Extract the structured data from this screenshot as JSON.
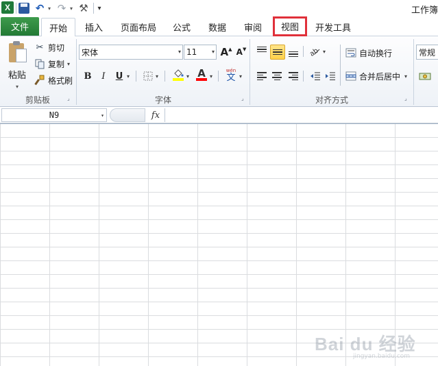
{
  "window": {
    "title": "工作簿"
  },
  "quick_access": {
    "logo_letter": "X",
    "undo_glyph": "↶",
    "redo_glyph": "↷",
    "tools_glyph": "⚒",
    "customize_glyph": "▾"
  },
  "tabs": [
    {
      "label": "文件",
      "state": "file"
    },
    {
      "label": "开始",
      "state": "active"
    },
    {
      "label": "插入"
    },
    {
      "label": "页面布局"
    },
    {
      "label": "公式"
    },
    {
      "label": "数据"
    },
    {
      "label": "审阅"
    },
    {
      "label": "视图",
      "state": "highlighted"
    },
    {
      "label": "开发工具"
    }
  ],
  "ribbon": {
    "clipboard": {
      "label": "剪贴板",
      "paste": "粘贴",
      "cut": "剪切",
      "copy": "复制",
      "format_painter": "格式刷"
    },
    "font": {
      "label": "字体",
      "font_name": "宋体",
      "font_size": "11",
      "grow_glyph": "A",
      "shrink_glyph": "A",
      "bold": "B",
      "italic": "I",
      "underline": "U",
      "font_color_glyph": "A",
      "phonetic_top": "wén",
      "phonetic_bottom": "文",
      "fill_color": "#ffff00",
      "text_color": "#ff0000"
    },
    "alignment": {
      "label": "对齐方式",
      "wrap_text": "自动换行",
      "merge_center": "合并后居中"
    },
    "number": {
      "format": "常规"
    }
  },
  "formula_bar": {
    "name_box": "N9",
    "fx": "fx",
    "value": ""
  },
  "watermark": {
    "logo": "Bai du 经验",
    "sub": "jingyan.baidu.com"
  },
  "colors": {
    "file_tab": "#237a35",
    "highlight_box": "#e0303a",
    "active_align": "#ffd24a"
  }
}
